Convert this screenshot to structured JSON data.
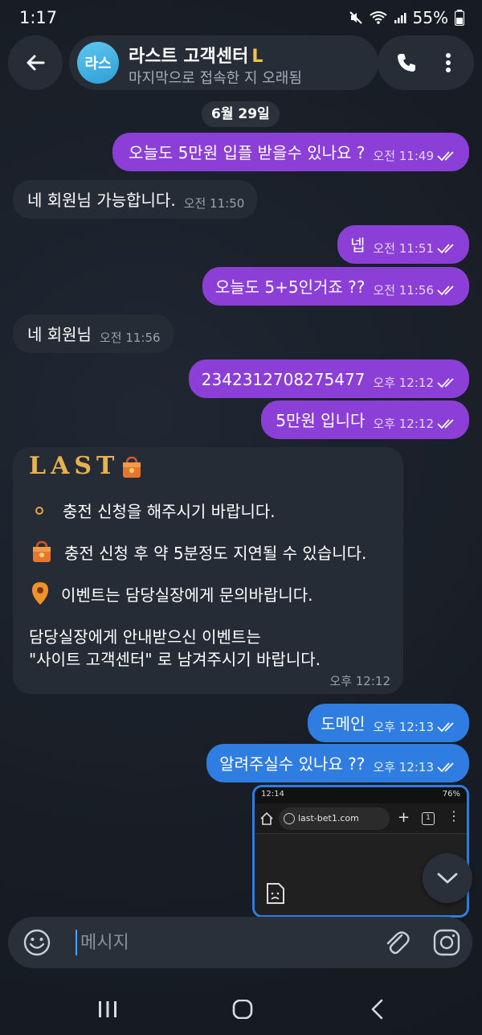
{
  "status_bar": {
    "time": "1:17",
    "battery": "55%"
  },
  "header": {
    "avatar_text": "라스",
    "title": "라스트 고객센터",
    "title_emoji": "L",
    "subtitle": "마지막으로 접속한 지 오래됨",
    "icons": [
      "back-arrow-icon",
      "phone-icon",
      "more-vertical-icon"
    ]
  },
  "date_chip": "6월 29일",
  "messages": [
    {
      "dir": "out",
      "text": "오늘도 5만원 입플 받을수 있나요 ?",
      "time": "오전 11:49"
    },
    {
      "dir": "in",
      "text": "네 회원님 가능합니다.",
      "time": "오전 11:50"
    },
    {
      "dir": "out",
      "text": "넵",
      "time": "오전 11:51"
    },
    {
      "dir": "out",
      "text": "오늘도 5+5인거죠 ??",
      "time": "오전 11:56"
    },
    {
      "dir": "in",
      "text": "네 회원님",
      "time": "오전 11:56"
    },
    {
      "dir": "out",
      "text": "2342312708275477",
      "time": "오후 12:12"
    },
    {
      "dir": "out",
      "text": "5만원 입니다",
      "time": "오후 12:12"
    }
  ],
  "card": {
    "title": "LAST",
    "line1": "충전 신청을 해주시기 바랍니다.",
    "line2": "충전 신청 후 약 5분정도 지연될 수 있습니다.",
    "line3": "이벤트는 담당실장에게 문의바랍니다.",
    "line4": "담당실장에게 안내받으신 이벤트는",
    "line5": "\"사이트 고객센터\" 로 남겨주시기 바랍니다.",
    "time": "오후 12:12"
  },
  "messages2": [
    {
      "dir": "out",
      "text": "도메인",
      "time": "오후 12:13"
    },
    {
      "dir": "out",
      "text": "알려주실수 있나요 ??",
      "time": "오후 12:13"
    }
  ],
  "screenshot": {
    "time": "12:14",
    "battery": "76%",
    "url": "last-bet1.com",
    "tabs": "1"
  },
  "input": {
    "placeholder": "메시지"
  },
  "colors": {
    "outgoing": "#8b3fd6",
    "incoming": "#262c36",
    "selected": "#2f7de0",
    "background": "#181d25"
  }
}
